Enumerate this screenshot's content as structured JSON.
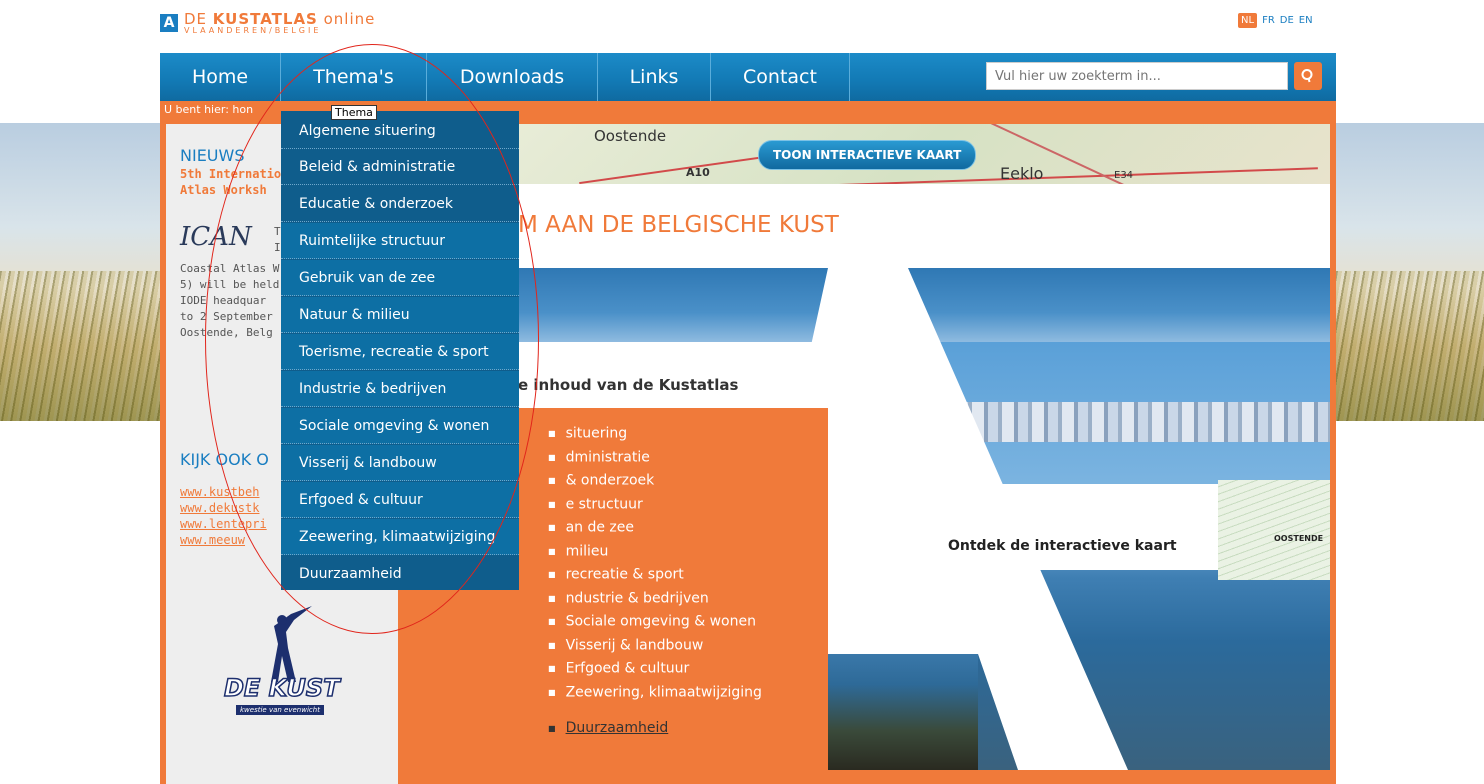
{
  "logo": {
    "mark": "A",
    "title_prefix": "DE ",
    "title_bold": "KUSTATLAS",
    "title_suffix": " online",
    "subtitle": "VLAANDEREN/BELGIE"
  },
  "languages": [
    "NL",
    "FR",
    "DE",
    "EN"
  ],
  "nav": {
    "items": [
      "Home",
      "Thema's",
      "Downloads",
      "Links",
      "Contact"
    ],
    "search_placeholder": "Vul hier uw zoekterm in..."
  },
  "breadcrumb": "U bent hier: hon",
  "sidebar": {
    "news_heading": "NIEUWS",
    "news_title_lines": [
      "5th Internatio",
      "Atlas Worksh"
    ],
    "ican_logo": "ICAN",
    "ican_side_text": [
      "T",
      "I"
    ],
    "news_body_lines": [
      "Coastal Atlas W",
      "5) will be held ",
      "IODE headquar",
      "to 2 September",
      "Oostende, Belg"
    ],
    "see_also_heading": "KIJK OOK O",
    "links": [
      "www.kustbeh",
      "www.dekustk",
      "www.lentepri",
      "www.meeuw"
    ],
    "dekust_logo": "DE KUST",
    "dekust_tagline": "kwestie van evenwicht"
  },
  "map": {
    "label_oostende": "Oostende",
    "label_eeklo": "Eeklo",
    "label_a10": "A10",
    "label_e34": "E34",
    "button": "TOON INTERACTIEVE KAART"
  },
  "main": {
    "welcome": "M AAN DE BELGISCHE KUST",
    "content_title": "e inhoud van de Kustatlas",
    "content_items": [
      "situering",
      "dministratie",
      "& onderzoek",
      "e structuur",
      "an de zee",
      "milieu",
      "recreatie & sport",
      "ndustrie & bedrijven",
      "Sociale omgeving & wonen",
      "Visserij & landbouw",
      "Erfgoed & cultuur",
      "Zeewering, klimaatwijziging"
    ],
    "duurzaam": "Duurzaamheid",
    "interactive_label": "Ontdek de interactieve kaart",
    "mini_map_label": "OOSTENDE"
  },
  "dropdown": {
    "tooltip": "Thema",
    "items": [
      "Algemene situering",
      "Beleid & administratie",
      "Educatie & onderzoek",
      "Ruimtelijke structuur",
      "Gebruik van de zee",
      "Natuur & milieu",
      "Toerisme, recreatie & sport",
      "Industrie & bedrijven",
      "Sociale omgeving & wonen",
      "Visserij & landbouw",
      "Erfgoed & cultuur",
      "Zeewering, klimaatwijziging",
      "Duurzaamheid"
    ]
  },
  "colors": {
    "brand_blue": "#1a7ec1",
    "brand_orange": "#f07a3a",
    "dropdown_bg": "#0f5d8c",
    "annotation": "#e1251b"
  }
}
